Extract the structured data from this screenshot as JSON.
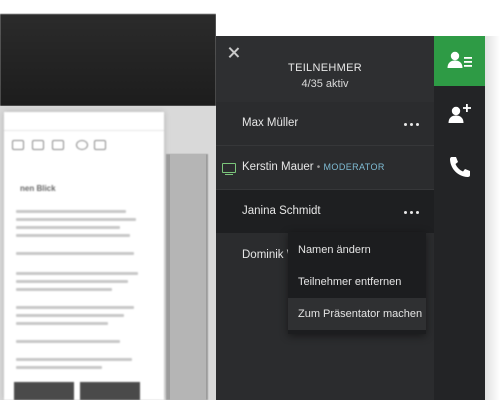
{
  "panel": {
    "title": "TEILNEHMER",
    "subtitle": "4/35 aktiv",
    "close_icon": "close-icon"
  },
  "participants": [
    {
      "name": "Max Müller",
      "role": "",
      "has_menu": true
    },
    {
      "name": "Kerstin Mauer",
      "role": "MODERATOR",
      "separator": "•",
      "presenting_icon": "monitor-icon"
    },
    {
      "name": "Janina Schmidt",
      "role": "",
      "has_menu": true,
      "selected": true
    },
    {
      "name": "Dominik W",
      "role": ""
    }
  ],
  "context_menu": {
    "items": [
      {
        "label": "Namen ändern"
      },
      {
        "label": "Teilnehmer entfernen"
      },
      {
        "label": "Zum Präsentator machen",
        "active": true
      }
    ]
  },
  "rail": {
    "buttons": [
      {
        "icon": "participants-list-icon",
        "active": true
      },
      {
        "icon": "add-user-icon",
        "active": false
      },
      {
        "icon": "phone-icon",
        "active": false
      }
    ],
    "accent_color": "#2e9b45"
  },
  "document": {
    "heading": "nen Blick"
  },
  "colors": {
    "panel_bg": "#2b2c2e",
    "moderator_label": "#7fbcd4",
    "presenter_icon": "#7bc67b"
  }
}
